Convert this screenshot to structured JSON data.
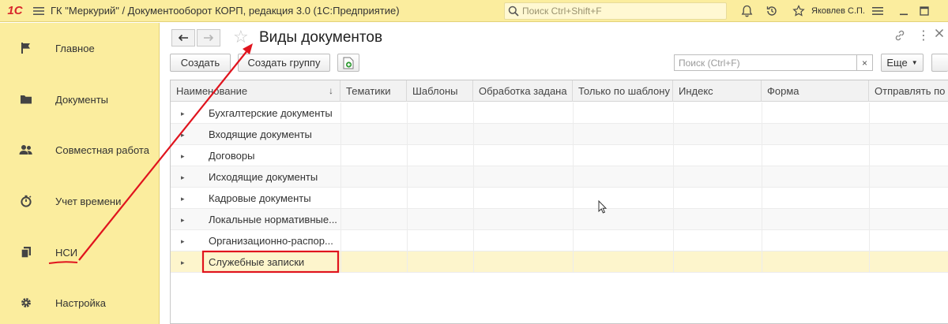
{
  "app": {
    "logo": "1С",
    "title": "ГК \"Меркурий\" / Документооборот КОРП, редакция 3.0  (1С:Предприятие)",
    "search_placeholder": "Поиск Ctrl+Shift+F",
    "user": "Яковлев С.П."
  },
  "sidebar": {
    "items": [
      {
        "label": "Главное",
        "icon": "flag-icon"
      },
      {
        "label": "Документы",
        "icon": "folder-icon"
      },
      {
        "label": "Совместная работа",
        "icon": "people-icon"
      },
      {
        "label": "Учет времени",
        "icon": "stopwatch-icon"
      },
      {
        "label": "НСИ",
        "icon": "books-icon"
      },
      {
        "label": "Настройка",
        "icon": "gear-icon"
      }
    ]
  },
  "form": {
    "title": "Виды документов",
    "toolbar": {
      "create": "Создать",
      "create_group": "Создать группу",
      "search_placeholder": "Поиск (Ctrl+F)",
      "clear": "×",
      "more": "Еще"
    },
    "columns": [
      "Наименование",
      "Тематики",
      "Шаблоны",
      "Обработка задана",
      "Только по шаблону",
      "Индекс",
      "Форма",
      "Отправлять по"
    ],
    "rows": [
      "Бухгалтерские документы",
      "Входящие документы",
      "Договоры",
      "Исходящие документы",
      "Кадровые документы",
      "Локальные нормативные...",
      "Организационно-распор...",
      "Служебные записки"
    ]
  },
  "colors": {
    "panel_yellow": "#fbed9e",
    "annotation_red": "#e0141e",
    "selected_row": "#fdf5cc"
  }
}
